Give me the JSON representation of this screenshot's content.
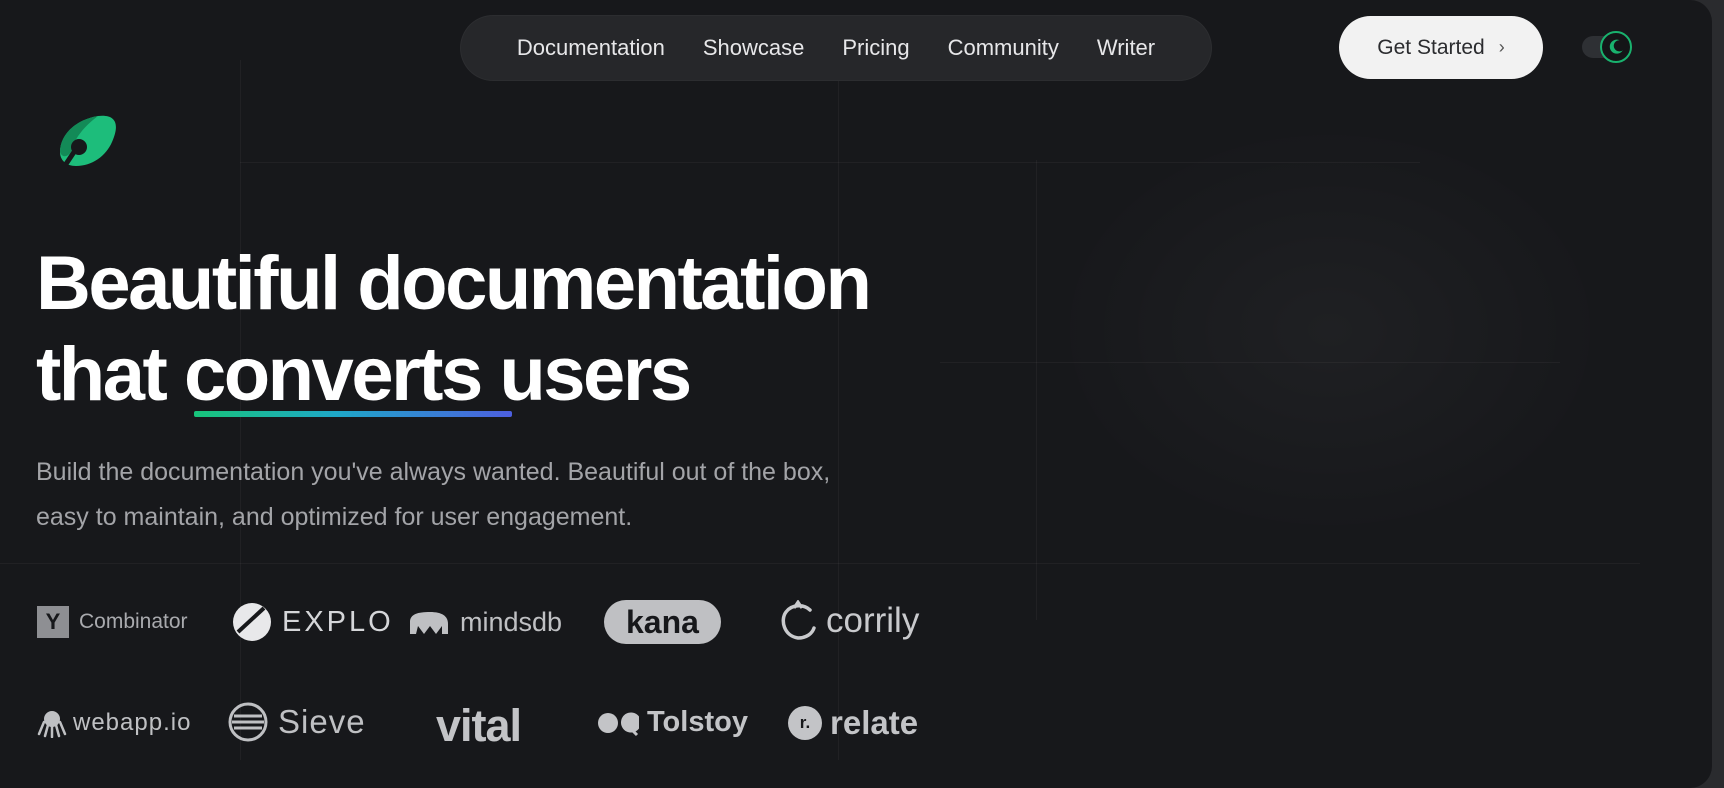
{
  "nav": {
    "links": [
      "Documentation",
      "Showcase",
      "Pricing",
      "Community",
      "Writer"
    ],
    "cta_label": "Get Started",
    "cta_chevron": "›",
    "theme_toggle_icon": "moon-icon"
  },
  "brand": {
    "logo_icon": "leaf-logo-icon",
    "accent_color": "#19b26e"
  },
  "hero": {
    "title_line1": "Beautiful documentation",
    "title_prefix": "that ",
    "title_highlight": "converts",
    "title_suffix": " users",
    "subtitle_line1": "Build the documentation you've always wanted. Beautiful out of the box,",
    "subtitle_line2": "easy to maintain, and optimized for user engagement."
  },
  "clients": {
    "row1": [
      {
        "name": "Y",
        "text": "Combinator"
      },
      {
        "name": "explo",
        "text": "EXPLO"
      },
      {
        "name": "mindsdb",
        "text": "mindsdb"
      },
      {
        "name": "kana",
        "text": "kana"
      },
      {
        "name": "corrily",
        "text": "corrily"
      }
    ],
    "row2": [
      {
        "name": "webapp",
        "text": "webapp.io"
      },
      {
        "name": "sieve",
        "text": "Sieve"
      },
      {
        "name": "vital",
        "text": "vital"
      },
      {
        "name": "tolstoy",
        "text": "Tolstoy"
      },
      {
        "name": "relate",
        "text": "relate",
        "mark": "r."
      }
    ]
  }
}
